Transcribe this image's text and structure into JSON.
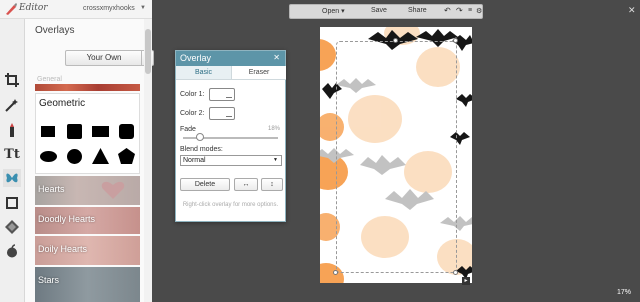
{
  "app": {
    "logo_text": "Editor",
    "username": "crossxmyxhooks"
  },
  "panel": {
    "title": "Overlays",
    "your_own_label": "Your Own",
    "category_label": "General",
    "geometric_title": "Geometric",
    "tiles": [
      "Hearts",
      "Doodly Hearts",
      "Doily Hearts",
      "Stars"
    ]
  },
  "tools": [
    "crop-icon",
    "magic-wand-icon",
    "touch-up-icon",
    "text-icon",
    "butterfly-icon",
    "frame-icon",
    "texture-icon",
    "apple-icon"
  ],
  "toolbar": {
    "open": "Open",
    "save": "Save",
    "share": "Share"
  },
  "dialog": {
    "title": "Overlay",
    "tab_basic": "Basic",
    "tab_eraser": "Eraser",
    "color1_label": "Color 1:",
    "color2_label": "Color 2:",
    "fade_label": "Fade",
    "fade_value": "18%",
    "fade_level": 0.18,
    "blend_label": "Blend modes:",
    "blend_value": "Normal",
    "delete_label": "Delete",
    "hint": "Right-click overlay for more options."
  },
  "zoom_label": "17%",
  "colors": {
    "accent": "#5d95a8",
    "pumpkin": "#f5a55a",
    "bat": "#1a1a1a"
  }
}
